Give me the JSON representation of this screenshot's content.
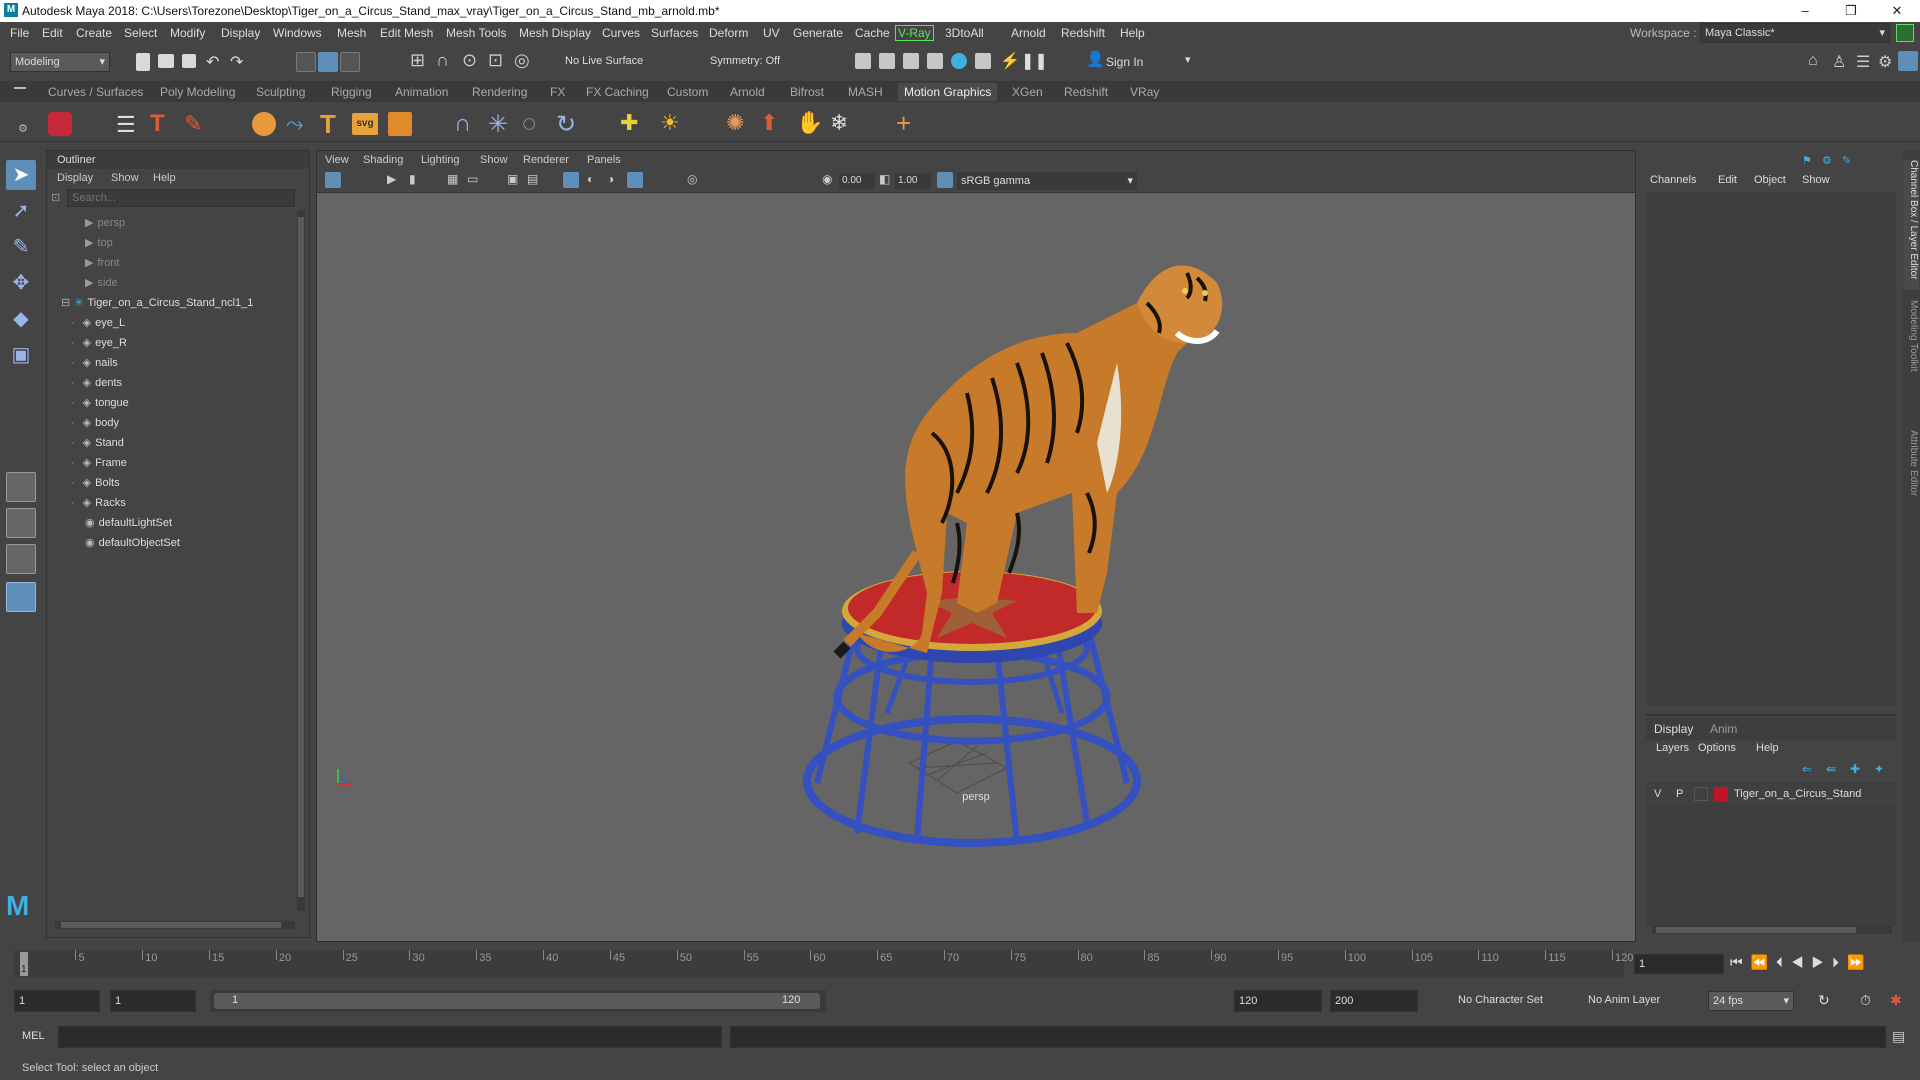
{
  "window": {
    "title": "Autodesk Maya 2018: C:\\Users\\Torezone\\Desktop\\Tiger_on_a_Circus_Stand_max_vray\\Tiger_on_a_Circus_Stand_mb_arnold.mb*",
    "minimize": "–",
    "maximize": "❐",
    "close": "✕"
  },
  "menubar": {
    "items": [
      "File",
      "Edit",
      "Create",
      "Select",
      "Modify",
      "Display",
      "Windows",
      "Mesh",
      "Edit Mesh",
      "Mesh Tools",
      "Mesh Display",
      "Curves",
      "Surfaces",
      "Deform",
      "UV",
      "Generate",
      "Cache",
      "V-Ray",
      "3DtoAll",
      "Arnold",
      "Redshift",
      "Help"
    ],
    "workspace_label": "Workspace :",
    "workspace_value": "Maya Classic*",
    "vray_color": "#5ee05e"
  },
  "statusline": {
    "mode": "Modeling",
    "live_surface": "No Live Surface",
    "symmetry": "Symmetry: Off",
    "sign_in": "Sign In"
  },
  "shelf_tabs": [
    "Curves / Surfaces",
    "Poly Modeling",
    "Sculpting",
    "Rigging",
    "Animation",
    "Rendering",
    "FX",
    "FX Caching",
    "Custom",
    "Arnold",
    "Bifrost",
    "MASH",
    "Motion Graphics",
    "XGen",
    "Redshift",
    "VRay"
  ],
  "shelf_active": "Motion Graphics",
  "outliner": {
    "title": "Outliner",
    "menu": [
      "Display",
      "Show",
      "Help"
    ],
    "search_placeholder": "Search...",
    "items": [
      {
        "label": "persp",
        "type": "camera",
        "dim": true
      },
      {
        "label": "top",
        "type": "camera",
        "dim": true
      },
      {
        "label": "front",
        "type": "camera",
        "dim": true
      },
      {
        "label": "side",
        "type": "camera",
        "dim": true
      },
      {
        "label": "Tiger_on_a_Circus_Stand_ncl1_1",
        "type": "group",
        "dim": false
      },
      {
        "label": "eye_L",
        "type": "mesh",
        "dim": false
      },
      {
        "label": "eye_R",
        "type": "mesh",
        "dim": false
      },
      {
        "label": "nails",
        "type": "mesh",
        "dim": false
      },
      {
        "label": "dents",
        "type": "mesh",
        "dim": false
      },
      {
        "label": "tongue",
        "type": "mesh",
        "dim": false
      },
      {
        "label": "body",
        "type": "mesh",
        "dim": false
      },
      {
        "label": "Stand",
        "type": "mesh",
        "dim": false
      },
      {
        "label": "Frame",
        "type": "mesh",
        "dim": false
      },
      {
        "label": "Bolts",
        "type": "mesh",
        "dim": false
      },
      {
        "label": "Racks",
        "type": "mesh",
        "dim": false
      },
      {
        "label": "defaultLightSet",
        "type": "set",
        "dim": false
      },
      {
        "label": "defaultObjectSet",
        "type": "set",
        "dim": false
      }
    ]
  },
  "viewport": {
    "menu": [
      "View",
      "Shading",
      "Lighting",
      "Show",
      "Renderer",
      "Panels"
    ],
    "exposure": "0.00",
    "gamma": "1.00",
    "colorspace": "sRGB gamma",
    "camera_label": "persp"
  },
  "channelbox": {
    "menu": [
      "Channels",
      "Edit",
      "Object",
      "Show"
    ],
    "side_tabs": [
      "Channel Box / Layer Editor",
      "Modeling Toolkit",
      "Attribute Editor"
    ]
  },
  "layers": {
    "tabs": [
      "Display",
      "Anim"
    ],
    "menu": [
      "Layers",
      "Options",
      "Help"
    ],
    "layer": {
      "v": "V",
      "p": "P",
      "name": "Tiger_on_a_Circus_Stand",
      "color": "#c0142a"
    }
  },
  "timeline": {
    "ticks": [
      "5",
      "10",
      "15",
      "20",
      "25",
      "30",
      "35",
      "40",
      "45",
      "50",
      "55",
      "60",
      "65",
      "70",
      "75",
      "80",
      "85",
      "90",
      "95",
      "100",
      "105",
      "110",
      "115",
      "120"
    ],
    "current_frame": "1",
    "current_field": "1"
  },
  "range": {
    "start": "1",
    "playback_start": "1",
    "slider_start": "1",
    "slider_end": "120",
    "playback_end": "120",
    "end": "200",
    "character_set": "No Character Set",
    "anim_layer": "No Anim Layer",
    "fps": "24 fps"
  },
  "cmdline": {
    "label": "MEL"
  },
  "helpline": {
    "text": "Select Tool: select an object"
  }
}
